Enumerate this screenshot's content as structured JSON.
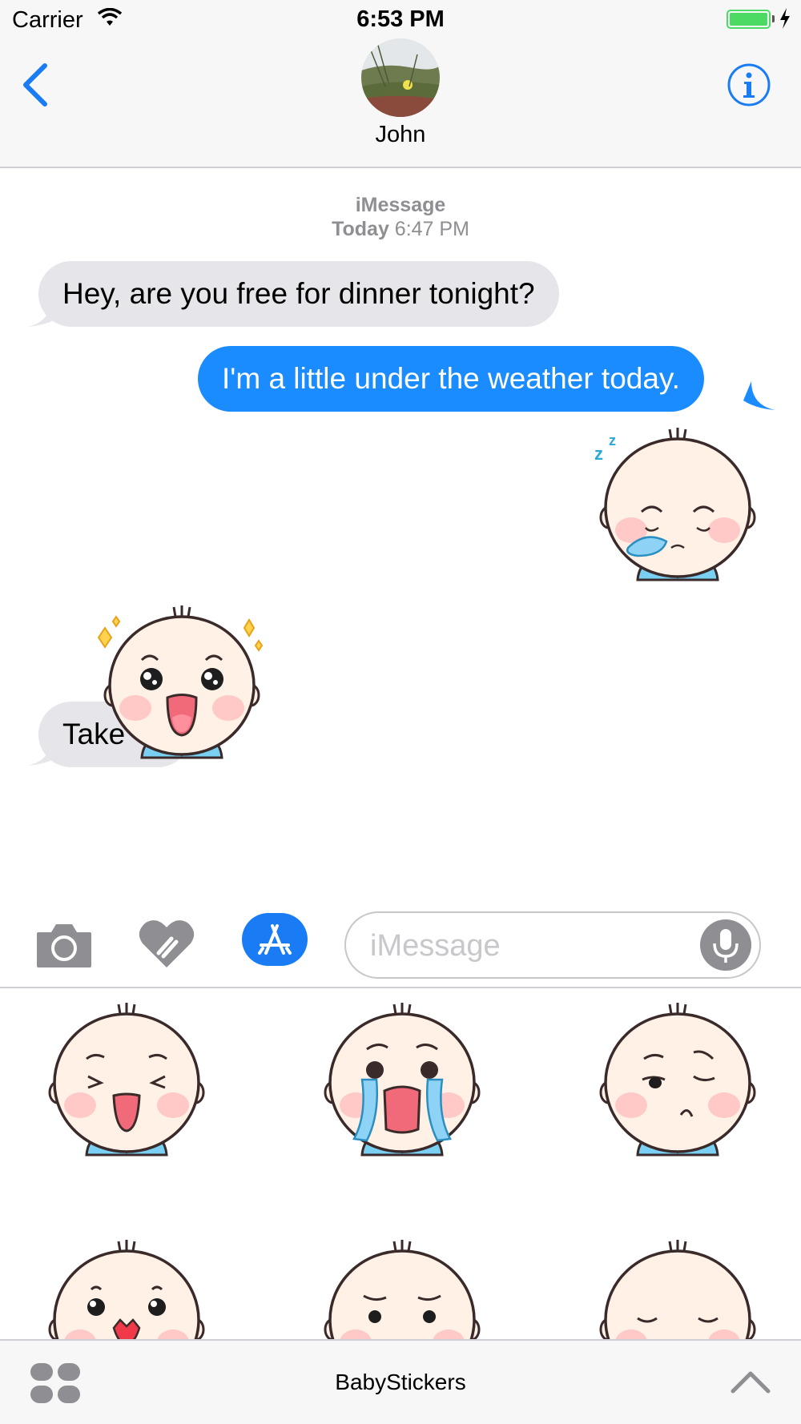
{
  "status_bar": {
    "carrier": "Carrier",
    "time": "6:53 PM"
  },
  "header": {
    "contact_name": "John"
  },
  "transcript": {
    "service": "iMessage",
    "timestamp_day": "Today",
    "timestamp_time": "6:47 PM",
    "messages": [
      {
        "from": "them",
        "text": "Hey, are you free for dinner tonight?"
      },
      {
        "from": "me",
        "text": "I'm a little under the weather today."
      },
      {
        "from": "me",
        "sticker": "sleepy-baby-sticker"
      },
      {
        "from": "them",
        "text": "Take"
      }
    ],
    "placed_sticker": "excited-baby-sticker"
  },
  "composer": {
    "placeholder": "iMessage"
  },
  "sticker_drawer": {
    "app_name": "BabyStickers",
    "stickers": [
      "laughing-baby",
      "crying-baby",
      "smirking-baby",
      "surprised-baby",
      "frowning-baby",
      "sleeping-baby"
    ]
  },
  "colors": {
    "accent": "#1a8cff",
    "incoming_bubble": "#e5e5ea",
    "battery": "#4cd964"
  }
}
